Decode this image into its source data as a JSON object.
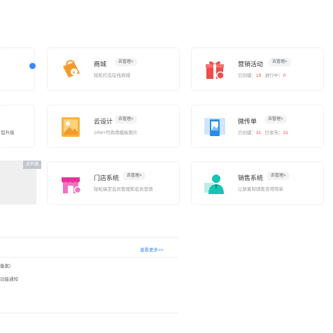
{
  "colors": {
    "accent_blue": "#3f85ff",
    "red": "#ef4b4b",
    "orange": "#f39a2b",
    "pink": "#ec3f9a",
    "teal": "#17c3b2"
  },
  "cards": {
    "mall": {
      "title": "商城",
      "manage": "去管理>",
      "desc": "轻松打造在线商城",
      "icon": "shopping-bag-icon"
    },
    "marketing": {
      "title": "营销活动",
      "manage": "去管理>",
      "created_label": "已创建：",
      "created_value": "19",
      "ongoing_label": "进行中：",
      "ongoing_value": "0",
      "icon": "gift-box-icon"
    },
    "cloud_design": {
      "title": "云设计",
      "manage": "去管理>",
      "desc": "10W+可商用模板图片",
      "icon": "image-icon"
    },
    "micro_flyer": {
      "title": "微传单",
      "manage": "去管理>",
      "created_label": "已创建：",
      "created_value": "31",
      "published_label": "已发布：",
      "published_value": "31",
      "icon": "flyer-icon"
    },
    "store_system": {
      "title": "门店系统",
      "manage": "去管理>",
      "desc": "轻松搞定会员管理和会员营销",
      "icon": "storefront-icon"
    },
    "sales_system": {
      "title": "销售系统",
      "manage": "去管理>",
      "desc": "让获客和销售变得简单",
      "icon": "salesperson-icon"
    }
  },
  "left_column": {
    "upgrade_text": "型升级",
    "unopened_badge": "未开通",
    "line1": "备案)",
    "line2": "功能通知"
  },
  "more_link": "查看更多>>"
}
